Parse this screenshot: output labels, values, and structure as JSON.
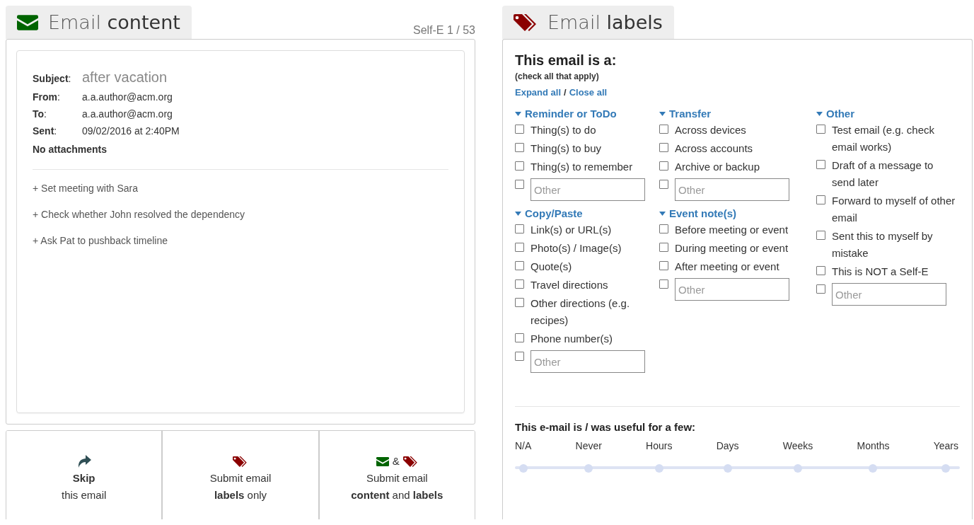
{
  "content_panel": {
    "tab": {
      "title": "Email",
      "title_bold": "content"
    },
    "counter": "Self-E 1 / 53",
    "email": {
      "fields": [
        {
          "label": "**Subject**:",
          "value": "after vacation",
          "kind": "subject"
        },
        {
          "label": "**From**:",
          "value": "a.a.author@acm.org",
          "kind": "plain"
        },
        {
          "label": "**To**:",
          "value": "a.a.author@acm.org",
          "kind": "plain"
        },
        {
          "label": "**Sent**:",
          "value": "09/02/2016 at 2:40PM",
          "kind": "plain"
        }
      ],
      "attachments": "No attachments",
      "body": [
        "+ Set meeting with Sara",
        "+ Check whether John resolved the dependency",
        "+ Ask Pat to pushback timeline"
      ]
    }
  },
  "actions": [
    {
      "kind": "skip",
      "lines": [
        "**Skip**",
        "this email"
      ]
    },
    {
      "kind": "labels",
      "lines": [
        "Submit email",
        "**labels** only"
      ]
    },
    {
      "kind": "both",
      "joiner": "&",
      "lines": [
        "Submit email",
        "**content** and **labels**"
      ]
    }
  ],
  "labels_panel": {
    "tab": {
      "title": "Email",
      "title_bold": "labels"
    },
    "heading": "This email is a:",
    "hint": "(check all that apply)",
    "links": [
      "Expand all",
      "Close all"
    ],
    "link_separator": "/",
    "columns": [
      {
        "groups": [
          {
            "title": "Reminder or ToDo",
            "expanded": true,
            "options": [
              {
                "label": "Thing(s) to do",
                "checked": false
              },
              {
                "label": "Thing(s) to buy",
                "checked": false
              },
              {
                "label": "Thing(s) to remember",
                "checked": false
              }
            ],
            "other": {
              "placeholder": "Other",
              "checked": false
            }
          },
          {
            "title": "Copy/Paste",
            "expanded": true,
            "options": [
              {
                "label": "Link(s) or URL(s)",
                "checked": false
              },
              {
                "label": "Photo(s) / Image(s)",
                "checked": false
              },
              {
                "label": "Quote(s)",
                "checked": false
              },
              {
                "label": "Travel directions",
                "checked": false
              },
              {
                "label": "Other directions (e.g. recipes)",
                "checked": false
              },
              {
                "label": "Phone number(s)",
                "checked": false
              }
            ],
            "other": {
              "placeholder": "Other",
              "checked": false
            }
          }
        ]
      },
      {
        "groups": [
          {
            "title": "Transfer",
            "expanded": true,
            "options": [
              {
                "label": "Across devices",
                "checked": false
              },
              {
                "label": "Across accounts",
                "checked": false
              },
              {
                "label": "Archive or backup",
                "checked": false
              }
            ],
            "other": {
              "placeholder": "Other",
              "checked": false
            }
          },
          {
            "title": "Event note(s)",
            "expanded": true,
            "options": [
              {
                "label": "Before meeting or event",
                "checked": false
              },
              {
                "label": "During meeting or event",
                "checked": false
              },
              {
                "label": "After meeting or event",
                "checked": false
              }
            ],
            "other": {
              "placeholder": "Other",
              "checked": false
            }
          }
        ]
      },
      {
        "groups": [
          {
            "title": "Other",
            "expanded": true,
            "options": [
              {
                "label": "Test email (e.g. check email works)",
                "checked": false
              },
              {
                "label": "Draft of a message to send later",
                "checked": false
              },
              {
                "label": "Forward to myself of other email",
                "checked": false
              },
              {
                "label": "Sent this to myself by mistake",
                "checked": false
              },
              {
                "label": "This is NOT a Self-E",
                "checked": false
              }
            ],
            "other": {
              "placeholder": "Other",
              "checked": false
            }
          }
        ]
      }
    ],
    "usefulness": {
      "title": "This e-mail is / was useful for a few:",
      "options": [
        {
          "label": "N/A",
          "selected": false
        },
        {
          "label": "Never",
          "selected": false
        },
        {
          "label": "Hours",
          "selected": false
        },
        {
          "label": "Days",
          "selected": false
        },
        {
          "label": "Weeks",
          "selected": false
        },
        {
          "label": "Months",
          "selected": false
        },
        {
          "label": "Years",
          "selected": false
        }
      ]
    }
  }
}
